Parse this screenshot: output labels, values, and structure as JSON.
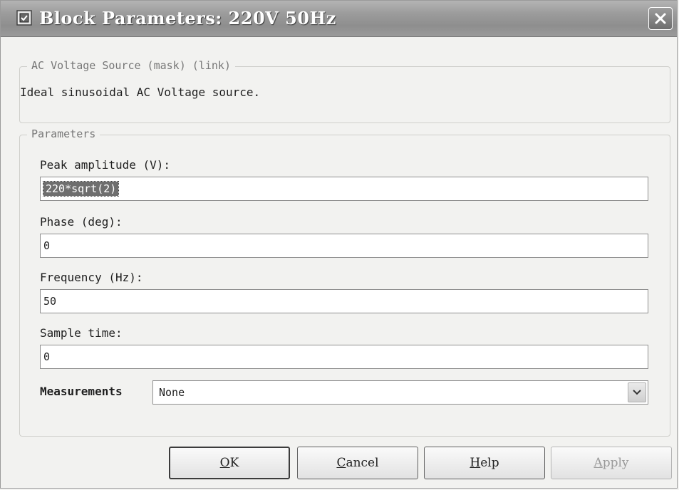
{
  "window": {
    "title": "Block Parameters: 220V 50Hz",
    "close_icon": "close-icon",
    "title_icon": "block-icon"
  },
  "mask": {
    "legend": "AC Voltage Source (mask) (link)",
    "description": "Ideal sinusoidal AC Voltage source."
  },
  "parameters": {
    "legend": "Parameters",
    "peak_amplitude": {
      "label": "Peak amplitude (V):",
      "value": "220*sqrt(2)",
      "selected": true
    },
    "phase": {
      "label": "Phase (deg):",
      "value": "0"
    },
    "frequency": {
      "label": "Frequency (Hz):",
      "value": "50"
    },
    "sample_time": {
      "label": "Sample time:",
      "value": "0"
    },
    "measurements": {
      "label": "Measurements",
      "value": "None"
    }
  },
  "buttons": {
    "ok": {
      "mnemonic": "O",
      "rest": "K"
    },
    "cancel": {
      "mnemonic": "C",
      "rest": "ancel"
    },
    "help": {
      "mnemonic": "H",
      "rest": "elp"
    },
    "apply": {
      "mnemonic": "A",
      "rest": "pply",
      "enabled": false
    }
  }
}
